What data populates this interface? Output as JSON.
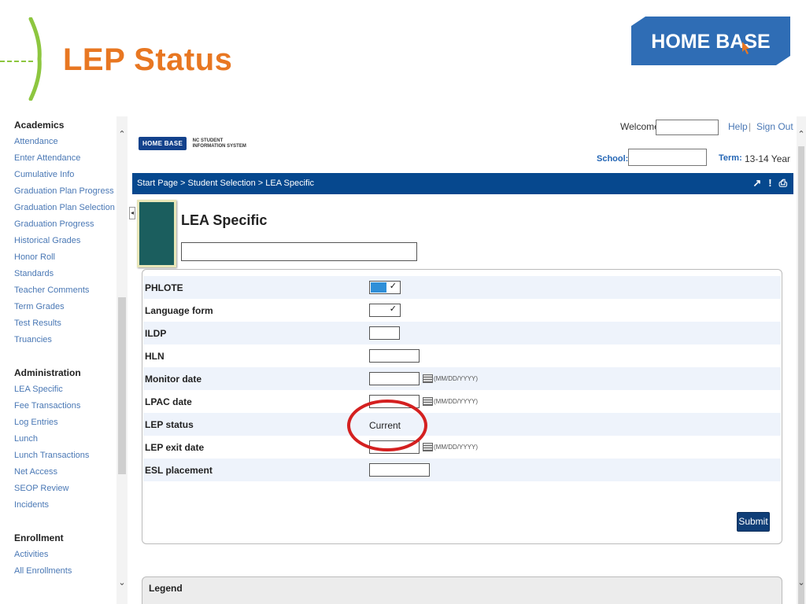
{
  "slide": {
    "title": "LEP Status",
    "brand_logo_text": "HOME BASE"
  },
  "app": {
    "logo_box": "HOME BASE",
    "logo_subtext_line1": "NC STUDENT",
    "logo_subtext_line2": "INFORMATION SYSTEM",
    "welcome_label": "Welcome,",
    "help_link": "Help",
    "sign_out_link": "Sign Out",
    "school_label": "School:",
    "term_label": "Term:",
    "term_value": "13-14 Year"
  },
  "sidebar": {
    "sections": [
      {
        "title": "Academics",
        "items": [
          "Attendance",
          "Enter Attendance",
          "Cumulative Info",
          "Graduation Plan Progress",
          "Graduation Plan Selection",
          "Graduation Progress",
          "Historical Grades",
          "Honor Roll",
          "Standards",
          "Teacher Comments",
          "Term Grades",
          "Test Results",
          "Truancies"
        ]
      },
      {
        "title": "Administration",
        "items": [
          "LEA Specific",
          "Fee Transactions",
          "Log Entries",
          "Lunch",
          "Lunch Transactions",
          "Net Access",
          "SEOP Review",
          "Incidents"
        ]
      },
      {
        "title": "Enrollment",
        "items": [
          "Activities",
          "All Enrollments"
        ]
      }
    ]
  },
  "breadcrumb": {
    "text": "Start Page > Student Selection > LEA Specific",
    "icons": [
      "pointer-icon",
      "alert-icon",
      "print-icon"
    ]
  },
  "page": {
    "heading": "LEA Specific"
  },
  "form": {
    "rows": [
      {
        "label": "PHLOTE"
      },
      {
        "label": "Language form"
      },
      {
        "label": "ILDP"
      },
      {
        "label": "HLN"
      },
      {
        "label": "Monitor date",
        "hint": "(MM/DD/YYYY)"
      },
      {
        "label": "LPAC date",
        "hint": "(MM/DD/YYYY)"
      },
      {
        "label": "LEP status",
        "value": "Current"
      },
      {
        "label": "LEP exit date",
        "hint": "(MM/DD/YYYY)"
      },
      {
        "label": "ESL placement"
      }
    ],
    "submit_label": "Submit"
  },
  "legend": {
    "title": "Legend"
  },
  "colors": {
    "title_orange": "#e87722",
    "accent_green": "#8dc63f",
    "nav_blue": "#06488e",
    "link_blue": "#4a78b5",
    "highlight_red": "#d42020"
  }
}
